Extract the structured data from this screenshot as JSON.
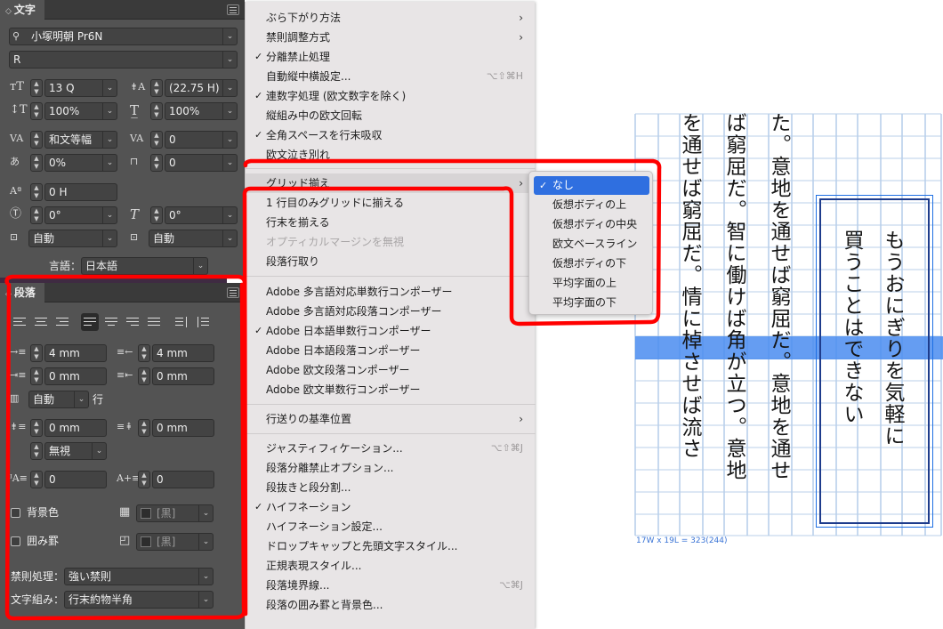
{
  "character_panel": {
    "tab_label": "文字",
    "font_family": "小塚明朝 Pr6N",
    "font_style": "R",
    "font_size": "13 Q",
    "leading": "(22.75 H)",
    "vertical_scale": "100%",
    "horizontal_scale": "100%",
    "kerning": "和文等幅",
    "tracking": "0",
    "tsume": "0%",
    "aki": "0",
    "baseline_shift": "0 H",
    "rotation": "0°",
    "skew": "0°",
    "aki_before": "自動",
    "aki_after": "自動",
    "language_label": "言語：",
    "language": "日本語"
  },
  "paragraph_panel": {
    "tab_label": "段落",
    "left_indent": "4 mm",
    "right_indent": "4 mm",
    "first_line_indent": "0 mm",
    "last_line_right_indent": "0 mm",
    "auto_leading": "自動",
    "line_unit": "行",
    "space_before": "0 mm",
    "space_after": "0 mm",
    "grid_align": "無視",
    "drop_cap_lines": "0",
    "drop_cap_chars": "0",
    "shading_label": "背景色",
    "shading_swatch": "[黒]",
    "border_label": "囲み罫",
    "border_swatch": "[黒]",
    "kinsoku_label": "禁則処理：",
    "kinsoku_value": "強い禁則",
    "mojikumi_label": "文字組み：",
    "mojikumi_value": "行末約物半角"
  },
  "menu": {
    "items": [
      {
        "label": "ぶら下がり方法",
        "submenu": true
      },
      {
        "label": "禁則調整方式",
        "submenu": true
      },
      {
        "label": "分離禁止処理",
        "checked": true
      },
      {
        "label": "自動縦中横設定...",
        "shortcut": "⌥⇧⌘H"
      },
      {
        "label": "連数字処理 (欧文数字を除く)",
        "checked": true
      },
      {
        "label": "縦組み中の欧文回転"
      },
      {
        "label": "全角スペースを行末吸収",
        "checked": true
      },
      {
        "label": "欧文泣き別れ"
      },
      {
        "label": "グリッド揃え",
        "submenu": true,
        "highlighted": true
      },
      {
        "label": "1 行目のみグリッドに揃える"
      },
      {
        "label": "行末を揃える"
      },
      {
        "label": "オプティカルマージンを無視",
        "disabled": true
      },
      {
        "label": "段落行取り"
      },
      {
        "label": "Adobe 多言語対応単数行コンポーザー"
      },
      {
        "label": "Adobe 多言語対応段落コンポーザー"
      },
      {
        "label": "Adobe 日本語単数行コンポーザー",
        "checked": true
      },
      {
        "label": "Adobe 日本語段落コンポーザー"
      },
      {
        "label": "Adobe 欧文段落コンポーザー"
      },
      {
        "label": "Adobe 欧文単数行コンポーザー"
      },
      {
        "label": "行送りの基準位置",
        "submenu": true
      },
      {
        "label": "ジャスティフィケーション...",
        "shortcut": "⌥⇧⌘J"
      },
      {
        "label": "段落分離禁止オプション..."
      },
      {
        "label": "段抜きと段分割..."
      },
      {
        "label": "ハイフネーション",
        "checked": true
      },
      {
        "label": "ハイフネーション設定..."
      },
      {
        "label": "ドロップキャップと先頭文字スタイル..."
      },
      {
        "label": "正規表現スタイル..."
      },
      {
        "label": "段落境界線...",
        "shortcut": "⌥⌘J"
      },
      {
        "label": "段落の囲み罫と背景色..."
      }
    ]
  },
  "submenu": {
    "items": [
      {
        "label": "なし",
        "checked": true
      },
      {
        "label": "仮想ボディの上"
      },
      {
        "label": "仮想ボディの中央"
      },
      {
        "label": "欧文ベースライン"
      },
      {
        "label": "仮想ボディの下"
      },
      {
        "label": "平均字面の上"
      },
      {
        "label": "平均字面の下"
      }
    ]
  },
  "document": {
    "columns": [
      "を通せば窮屈だ。情に棹させば流さ",
      "ば窮屈だ。智に働けば角が立つ。意地",
      "た。意地を通せば窮屈だ。意地を通せ"
    ],
    "frame_columns": [
      "もうおにぎりを気軽に",
      "買うことはできない"
    ],
    "frame_info": "17W x 19L = 323(244)",
    "accent": "#1e6fe3",
    "highlight": "#4a8cf0"
  },
  "annotations": {
    "marker_color": "#ff0000"
  }
}
